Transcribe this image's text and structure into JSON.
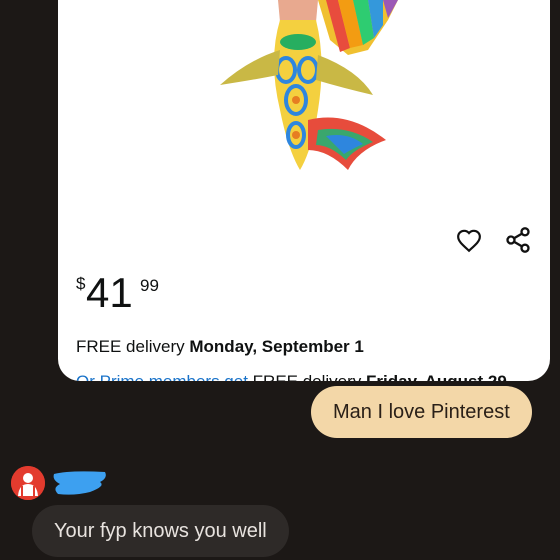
{
  "product": {
    "price_currency": "$",
    "price_whole": "41",
    "price_fraction": "99",
    "delivery_prefix": "FREE delivery",
    "delivery_date": "Monday, September 1",
    "cutoff_text_blue": "Or Prime members get",
    "cutoff_text": " FREE delivery",
    "cutoff_date": " Friday, August 29"
  },
  "messages": {
    "sent_text": "Man I love Pinterest",
    "received_text": "Your fyp knows you well"
  },
  "icons": {
    "wishlist": "heart-outline-icon",
    "share": "share-icon",
    "sender": "avatar-icon"
  },
  "colors": {
    "background": "#1c1816",
    "sent_bubble": "#f3d7a8",
    "received_bubble": "#2e2a28",
    "avatar": "#e33b2e",
    "redaction": "#3da0f0"
  }
}
